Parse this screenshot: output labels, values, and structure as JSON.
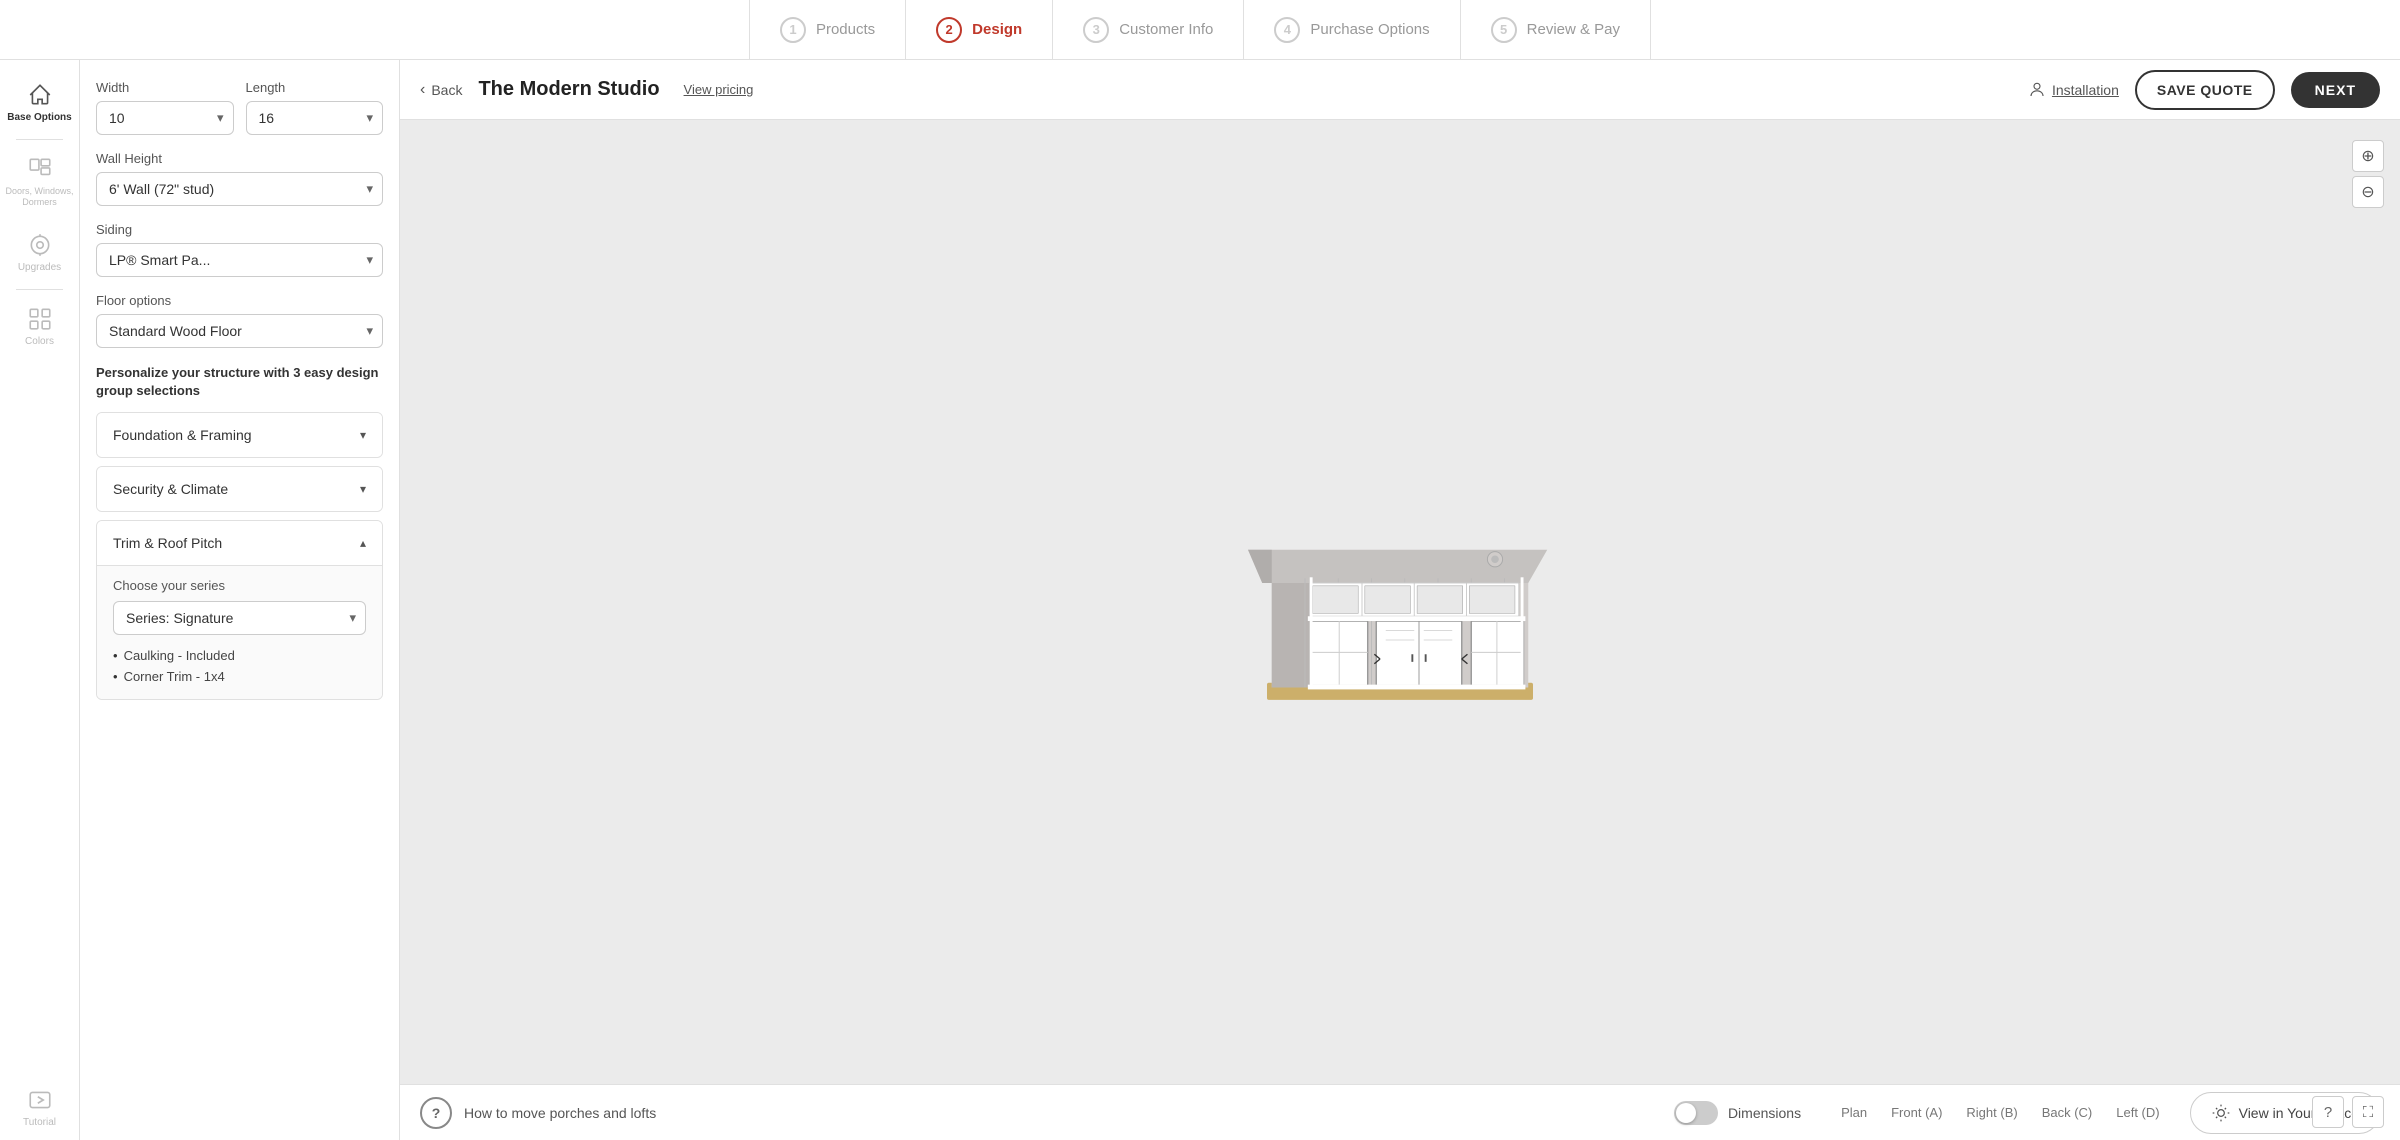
{
  "nav": {
    "steps": [
      {
        "id": "products",
        "num": "1",
        "label": "Products",
        "active": false
      },
      {
        "id": "design",
        "num": "2",
        "label": "Design",
        "active": true
      },
      {
        "id": "customer-info",
        "num": "3",
        "label": "Customer Info",
        "active": false
      },
      {
        "id": "purchase-options",
        "num": "4",
        "label": "Purchase Options",
        "active": false
      },
      {
        "id": "review-pay",
        "num": "5",
        "label": "Review & Pay",
        "active": false
      }
    ]
  },
  "sidebar": {
    "items": [
      {
        "id": "base-options",
        "label": "Base Options",
        "active": true
      },
      {
        "id": "doors-windows-dormers",
        "label": "Doors, Windows, Dormers",
        "active": false
      },
      {
        "id": "upgrades",
        "label": "Upgrades",
        "active": false
      },
      {
        "id": "colors",
        "label": "Colors",
        "active": false
      },
      {
        "id": "tutorial",
        "label": "Tutorial",
        "active": false
      }
    ]
  },
  "options": {
    "width_label": "Width",
    "width_value": "10",
    "length_label": "Length",
    "length_value": "16",
    "wall_height_label": "Wall Height",
    "wall_height_value": "6' Wall (72\" stud)",
    "siding_label": "Siding",
    "siding_value": "LP® Smart Pa...",
    "floor_label": "Floor options",
    "floor_value": "Standard Wood Floor",
    "personalize_text": "Personalize your structure with 3 easy design group selections"
  },
  "accordions": [
    {
      "id": "foundation-framing",
      "label": "Foundation & Framing",
      "expanded": false,
      "arrow": "▾"
    },
    {
      "id": "security-climate",
      "label": "Security & Climate",
      "expanded": false,
      "arrow": "▾"
    },
    {
      "id": "trim-roof-pitch",
      "label": "Trim & Roof Pitch",
      "expanded": true,
      "arrow": "▴",
      "series_label": "Choose your series",
      "series_value": "Series: Signature",
      "bullets": [
        "Caulking - Included",
        "Corner Trim - 1x4"
      ]
    }
  ],
  "header": {
    "back_label": "Back",
    "title": "The Modern Studio",
    "view_pricing": "View pricing",
    "installation_label": "Installation",
    "save_quote_label": "SAVE QUOTE",
    "next_label": "NEXT"
  },
  "bottom_bar": {
    "help_icon": "?",
    "how_to_text": "How to move porches and lofts",
    "dimensions_label": "Dimensions",
    "view_tabs": [
      "Plan",
      "Front (A)",
      "Right (B)",
      "Back (C)",
      "Left (D)"
    ],
    "view_space_label": "View in Your Space"
  },
  "zoom": {
    "plus": "+",
    "minus": "−"
  }
}
